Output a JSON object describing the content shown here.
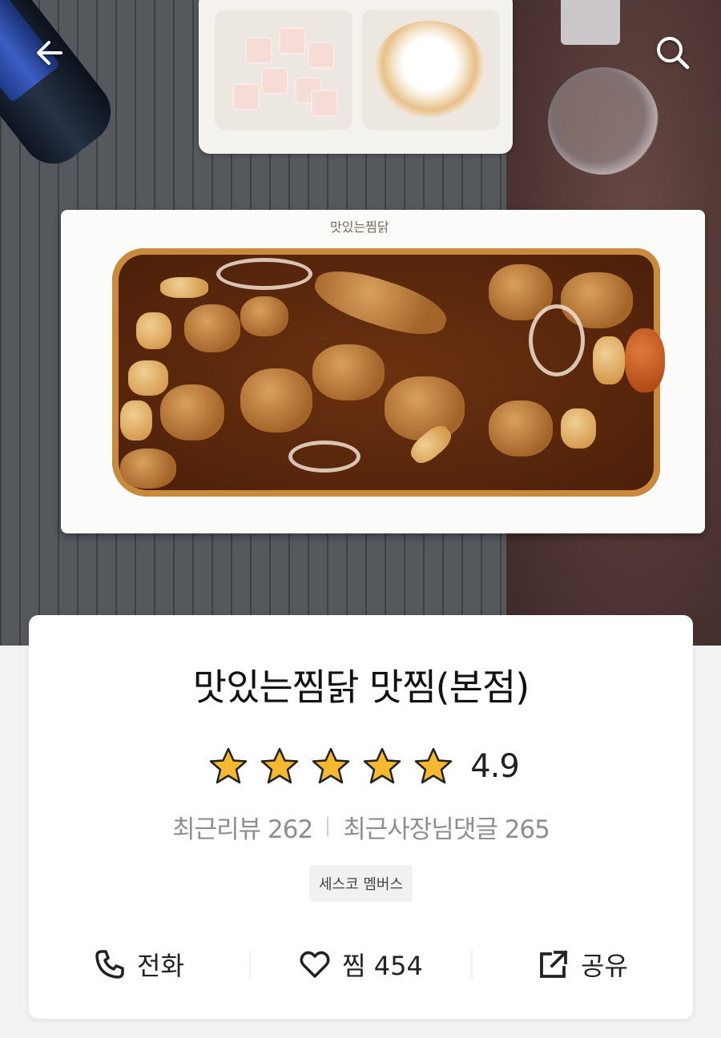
{
  "navigation": {
    "back_icon": "arrow-left-icon",
    "search_icon": "search-icon"
  },
  "restaurant": {
    "name": "맛있는찜닭 맛찜(본점)",
    "rating": {
      "value": "4.9",
      "stars_filled": 5,
      "stars_total": 5,
      "star_color": "#f5b82e"
    },
    "stats": {
      "recent_reviews": "최근리뷰 262",
      "owner_replies": "최근사장님댓글 265"
    },
    "badge": "세스코 멤버스",
    "platter_logo": "맛있는찜닭"
  },
  "actions": {
    "call": {
      "label": "전화",
      "icon": "phone-icon"
    },
    "favorite": {
      "label": "찜 454",
      "icon": "heart-icon"
    },
    "share": {
      "label": "공유",
      "icon": "share-icon"
    }
  }
}
